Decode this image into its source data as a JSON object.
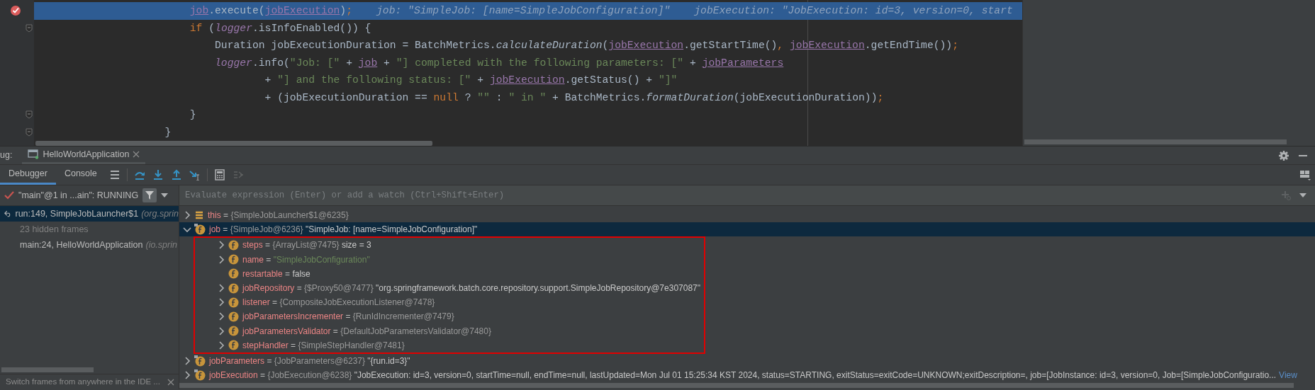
{
  "editor": {
    "lines": [
      {
        "current": true,
        "breakpoint": true,
        "fold_marker": false,
        "tokens": [
          {
            "text": "            job",
            "kind": "field"
          },
          {
            "text": ".execute(",
            "kind": "plain"
          },
          {
            "text": "jobExecution",
            "kind": "field"
          },
          {
            "text": ")",
            "kind": "plain"
          },
          {
            "text": ";",
            "kind": "keyword"
          }
        ],
        "hints": [
          "job: \"SimpleJob: [name=SimpleJobConfiguration]\"",
          "jobExecution: \"JobExecution: id=3, version=0, start"
        ]
      },
      {
        "current": false,
        "breakpoint": false,
        "fold_marker": true,
        "tokens": [
          {
            "text": "            if",
            "kind": "keyword"
          },
          {
            "text": " (",
            "kind": "plain"
          },
          {
            "text": "logger",
            "kind": "logger"
          },
          {
            "text": ".isInfoEnabled()) {",
            "kind": "plain"
          }
        ]
      },
      {
        "current": false,
        "breakpoint": false,
        "fold_marker": false,
        "tokens": [
          {
            "text": "                Duration jobExecutionDuration = BatchMetrics.",
            "kind": "plain"
          },
          {
            "text": "calculateDuration",
            "kind": "static"
          },
          {
            "text": "(",
            "kind": "plain"
          },
          {
            "text": "jobExecution",
            "kind": "field"
          },
          {
            "text": ".getStartTime()",
            "kind": "plain"
          },
          {
            "text": ", ",
            "kind": "keyword"
          },
          {
            "text": "jobExecution",
            "kind": "field"
          },
          {
            "text": ".getEndTime())",
            "kind": "plain"
          },
          {
            "text": ";",
            "kind": "keyword"
          }
        ]
      },
      {
        "current": false,
        "breakpoint": false,
        "fold_marker": false,
        "tokens": [
          {
            "text": "                logger",
            "kind": "logger"
          },
          {
            "text": ".info(",
            "kind": "plain"
          },
          {
            "text": "\"Job: [\"",
            "kind": "string"
          },
          {
            "text": " + ",
            "kind": "plain"
          },
          {
            "text": "job",
            "kind": "field"
          },
          {
            "text": " + ",
            "kind": "plain"
          },
          {
            "text": "\"] completed with the following parameters: [\"",
            "kind": "string"
          },
          {
            "text": " + ",
            "kind": "plain"
          },
          {
            "text": "jobParameters",
            "kind": "field"
          }
        ]
      },
      {
        "current": false,
        "breakpoint": false,
        "fold_marker": false,
        "tokens": [
          {
            "text": "                        + ",
            "kind": "plain"
          },
          {
            "text": "\"] and the following status: [\"",
            "kind": "string"
          },
          {
            "text": " + ",
            "kind": "plain"
          },
          {
            "text": "jobExecution",
            "kind": "field"
          },
          {
            "text": ".getStatus() + ",
            "kind": "plain"
          },
          {
            "text": "\"]\"",
            "kind": "string"
          }
        ]
      },
      {
        "current": false,
        "breakpoint": false,
        "fold_marker": false,
        "tokens": [
          {
            "text": "                        + (jobExecutionDuration == ",
            "kind": "plain"
          },
          {
            "text": "null",
            "kind": "keyword"
          },
          {
            "text": " ? ",
            "kind": "plain"
          },
          {
            "text": "\"\"",
            "kind": "string"
          },
          {
            "text": " : ",
            "kind": "plain"
          },
          {
            "text": "\" in \"",
            "kind": "string"
          },
          {
            "text": " + BatchMetrics.",
            "kind": "plain"
          },
          {
            "text": "formatDuration",
            "kind": "static"
          },
          {
            "text": "(jobExecutionDuration))",
            "kind": "plain"
          },
          {
            "text": ";",
            "kind": "keyword"
          }
        ]
      },
      {
        "current": false,
        "breakpoint": false,
        "fold_marker": true,
        "tokens": [
          {
            "text": "            }",
            "kind": "plain"
          }
        ]
      },
      {
        "current": false,
        "breakpoint": false,
        "fold_marker": true,
        "tokens": [
          {
            "text": "        }",
            "kind": "plain"
          }
        ]
      }
    ]
  },
  "debug_panel": {
    "title": "ug:",
    "run_tab": "HelloWorldApplication",
    "view_tabs": [
      {
        "label": "Debugger",
        "selected": true
      },
      {
        "label": "Console",
        "selected": false
      }
    ],
    "thread_selector": "\"main\"@1 in ...ain\": RUNNING",
    "frames": [
      {
        "kind": "frame",
        "text": "run:149, SimpleJobLauncher$1",
        "location": "(org.sprin",
        "selected": true
      },
      {
        "kind": "hidden",
        "text": "23 hidden frames",
        "selected": false
      },
      {
        "kind": "frame",
        "text": "main:24, HelloWorldApplication",
        "location": "(io.sprin",
        "selected": false
      }
    ],
    "frames_hint": "Switch frames from anywhere in the IDE ...",
    "evaluate": {
      "placeholder": "Evaluate expression (Enter) or add a watch (Ctrl+Shift+Enter)"
    },
    "variables": [
      {
        "kind": "list",
        "name": "this",
        "operator": "=",
        "type": "{SimpleJobLauncher$1@6235}",
        "expandable": true,
        "expanded": false,
        "selected": false
      },
      {
        "kind": "field-marked",
        "name": "job",
        "operator": "=",
        "type": "{SimpleJob@6236}",
        "value": "\"SimpleJob: [name=SimpleJobConfiguration]\"",
        "expandable": true,
        "expanded": true,
        "selected": true,
        "children_outlined": true,
        "children": [
          {
            "kind": "field",
            "name": "steps",
            "operator": "=",
            "type": "{ArrayList@7475}",
            "value": " size = 3",
            "expandable": true,
            "expanded": false,
            "selected": false
          },
          {
            "kind": "string-field",
            "name": "name",
            "operator": "=",
            "value": "\"SimpleJobConfiguration\"",
            "expandable": true,
            "expanded": false,
            "selected": false
          },
          {
            "kind": "field",
            "name": "restartable",
            "operator": "=",
            "value": "false",
            "expandable": false,
            "selected": false
          },
          {
            "kind": "field",
            "name": "jobRepository",
            "operator": "=",
            "type": "{$Proxy50@7477}",
            "value": "\"org.springframework.batch.core.repository.support.SimpleJobRepository@7e307087\"",
            "expandable": true,
            "expanded": false,
            "selected": false
          },
          {
            "kind": "field",
            "name": "listener",
            "operator": "=",
            "type": "{CompositeJobExecutionListener@7478}",
            "expandable": true,
            "expanded": false,
            "selected": false
          },
          {
            "kind": "field",
            "name": "jobParametersIncrementer",
            "operator": "=",
            "type": "{RunIdIncrementer@7479}",
            "expandable": true,
            "expanded": false,
            "selected": false
          },
          {
            "kind": "field",
            "name": "jobParametersValidator",
            "operator": "=",
            "type": "{DefaultJobParametersValidator@7480}",
            "expandable": true,
            "expanded": false,
            "selected": false
          },
          {
            "kind": "field",
            "name": "stepHandler",
            "operator": "=",
            "type": "{SimpleStepHandler@7481}",
            "expandable": true,
            "expanded": false,
            "selected": false
          }
        ]
      },
      {
        "kind": "field-marked",
        "name": "jobParameters",
        "operator": "=",
        "type": "{JobParameters@6237}",
        "value": "\"{run.id=3}\"",
        "expandable": true,
        "expanded": false,
        "selected": false
      },
      {
        "kind": "field-marked",
        "name": "jobExecution",
        "operator": "=",
        "type": "{JobExecution@6238}",
        "value": "\"JobExecution: id=3, version=0, startTime=null, endTime=null, lastUpdated=Mon Jul 01 15:25:34 KST 2024, status=STARTING, exitStatus=exitCode=UNKNOWN;exitDescription=, job=[JobInstance: id=3, version=0, Job=[SimpleJobConfiguratio...",
        "link": "View",
        "expandable": true,
        "expanded": false,
        "selected": false
      }
    ]
  }
}
